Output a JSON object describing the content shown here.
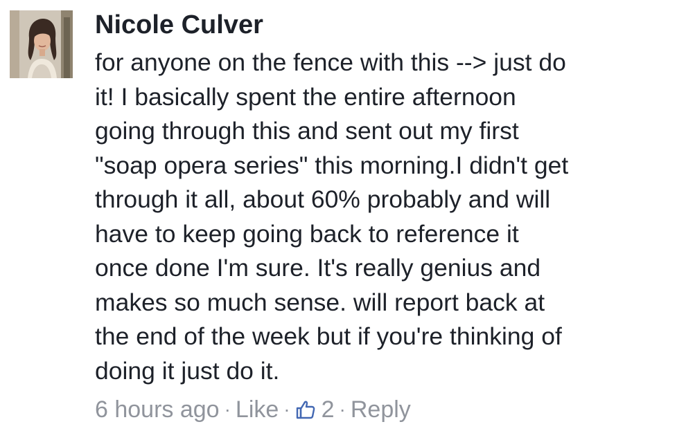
{
  "comment": {
    "author": "Nicole Culver",
    "body_lines": [
      "for anyone on the fence with this --> just do",
      "it! I basically spent the entire afternoon",
      "going through this and sent out my first",
      "\"soap opera series\" this morning.I didn't get",
      "through it all, about 60% probably and will",
      "have to keep going back to reference it",
      "once done I'm sure. It's really genius and",
      "makes so much sense. will report back at",
      "the end of the week but if you're thinking of",
      "doing it just do it."
    ],
    "timestamp": "6 hours ago",
    "like_label": "Like",
    "like_count": "2",
    "reply_label": "Reply",
    "separator": "·",
    "like_icon": "thumbs-up-icon",
    "colors": {
      "text": "#1d2129",
      "meta": "#90949c",
      "like_icon": "#4267b2"
    }
  }
}
